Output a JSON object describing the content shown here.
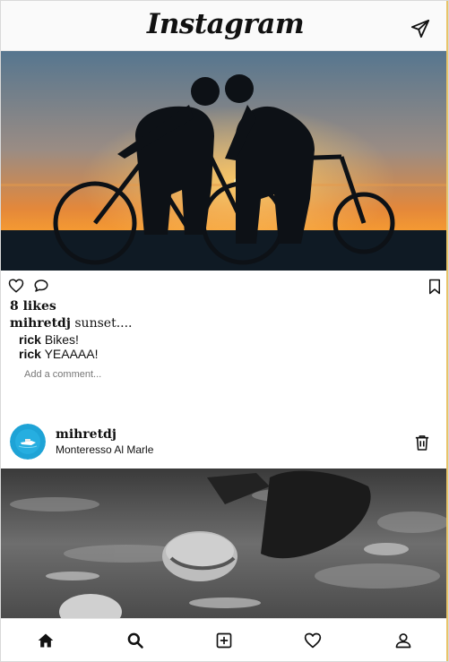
{
  "header": {
    "logo": "Instagram",
    "icon": "paper-plane-icon"
  },
  "post1": {
    "likes": "8 likes",
    "caption_user": "mihretdj",
    "caption_text": "sunset....",
    "comments": [
      {
        "user": "rick",
        "text": "Bikes!"
      },
      {
        "user": "rick",
        "text": "YEAAAA!"
      }
    ],
    "comment_placeholder": "Add a comment...",
    "icons": [
      "heart-icon",
      "comment-icon",
      "bookmark-icon"
    ]
  },
  "post2": {
    "username": "mihretdj",
    "location": "Monteresso Al Marle",
    "icons": [
      "trash-icon"
    ]
  },
  "nav": {
    "icons": [
      "home-icon",
      "search-icon",
      "plus-square-icon",
      "heart-icon",
      "user-icon"
    ]
  },
  "colors": {
    "sky_top": "#5d7d9a",
    "sunset_orange": "#f08a2a",
    "sea": "#1d3550",
    "silhouette": "#0d1116",
    "avatar_blue": "#1ea3d6"
  }
}
